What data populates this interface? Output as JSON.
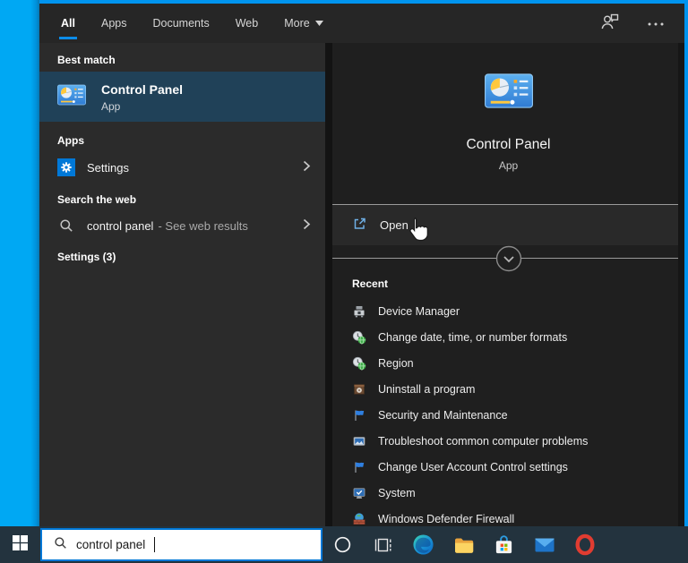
{
  "colors": {
    "desktop_blue": "#00a8f3",
    "window_border_blue": "#0094ef",
    "accent_blue": "#0078d7",
    "selected_row": "#204158",
    "taskbar_bg": "#23333e",
    "left_panel_bg": "#2b2b2b",
    "right_panel_bg": "#1f1f1f",
    "tab_underline": "#0c8ce8"
  },
  "tabs": {
    "items": [
      {
        "label": "All"
      },
      {
        "label": "Apps"
      },
      {
        "label": "Documents"
      },
      {
        "label": "Web"
      },
      {
        "label": "More"
      }
    ]
  },
  "left": {
    "best_match_header": "Best match",
    "best_match": {
      "title": "Control Panel",
      "subtitle": "App"
    },
    "apps_header": "Apps",
    "apps_item": "Settings",
    "web_header": "Search the web",
    "web_result": {
      "query": "control panel",
      "suffix": "- See web results"
    },
    "settings_header": "Settings (3)"
  },
  "right": {
    "app_title": "Control Panel",
    "app_subtitle": "App",
    "open_label": "Open",
    "recent_header": "Recent",
    "recent_items": [
      "Device Manager",
      "Change date, time, or number formats",
      "Region",
      "Uninstall a program",
      "Security and Maintenance",
      "Troubleshoot common computer problems",
      "Change User Account Control settings",
      "System",
      "Windows Defender Firewall"
    ]
  },
  "taskbar": {
    "search_value": "control panel"
  }
}
